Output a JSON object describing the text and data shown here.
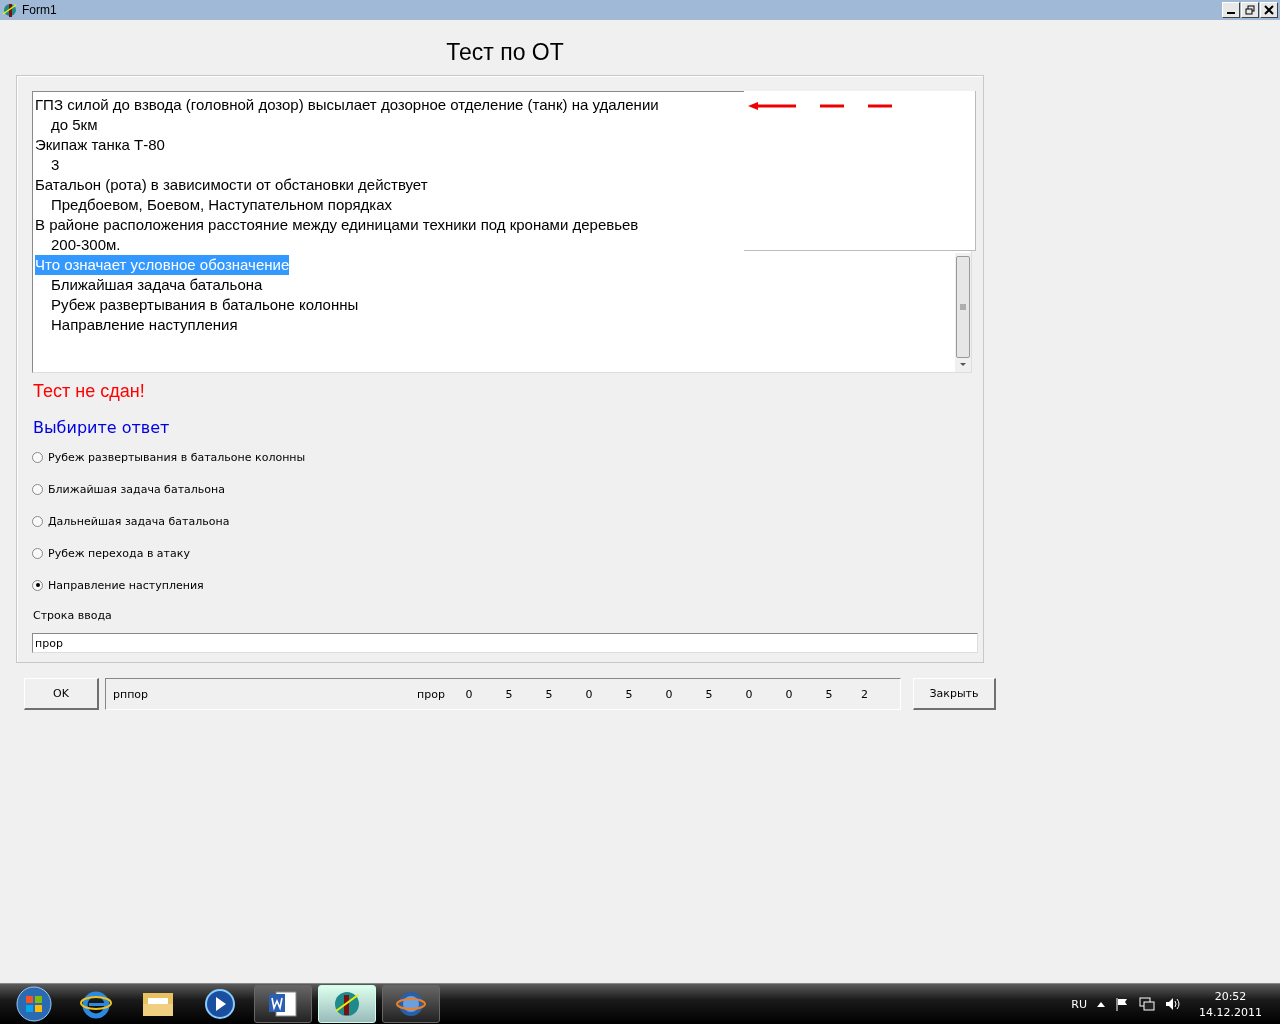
{
  "window": {
    "title": "Form1",
    "controls": [
      {
        "kind": "minimize"
      },
      {
        "kind": "restore"
      },
      {
        "kind": "close"
      }
    ]
  },
  "heading": "Тест по ОТ",
  "memo": {
    "items": [
      {
        "text": "ГПЗ силой до взвода (головной дозор) высылает дозорное отделение (танк) на удалении",
        "selected": false,
        "children": [
          {
            "text": "до 5км",
            "selected": false
          }
        ]
      },
      {
        "text": "Экипаж танка Т-80",
        "selected": false,
        "children": [
          {
            "text": "3",
            "selected": false
          }
        ]
      },
      {
        "text": "Батальон (рота) в зависимости от обстановки действует",
        "selected": false,
        "children": [
          {
            "text": "Предбоевом, Боевом, Наступательном порядках",
            "selected": false
          }
        ]
      },
      {
        "text": "В районе расположения расстояние между единицами техники под кронами деревьев",
        "selected": false,
        "children": [
          {
            "text": "200-300м.",
            "selected": false
          }
        ]
      },
      {
        "text": "Что означает условное обозначение",
        "selected": true,
        "children": [
          {
            "text": "Ближайшая задача батальона",
            "selected": false
          },
          {
            "text": "Рубеж развертывания в батальоне колонны",
            "selected": false
          },
          {
            "text": "Направление наступления",
            "selected": false
          }
        ]
      }
    ]
  },
  "result": "Тест не сдан!",
  "prompt": "Выбирите ответ",
  "options": [
    {
      "label": "Рубеж развертывания в батальоне колонны",
      "selected": false
    },
    {
      "label": "Ближайшая задача батальона",
      "selected": false
    },
    {
      "label": "Дальнейшая задача батальона",
      "selected": false
    },
    {
      "label": "Рубеж перехода в атаку",
      "selected": false
    },
    {
      "label": "Направление наступления",
      "selected": true
    }
  ],
  "input": {
    "label": "Строка ввода",
    "value": "прор"
  },
  "ok_button": "OK",
  "status": {
    "text_1": "рппор",
    "text_2": "прор",
    "scores": [
      "0",
      "5",
      "5",
      "0",
      "5",
      "0",
      "5",
      "0",
      "0",
      "5"
    ],
    "total": "2"
  },
  "close_button": "Закрыть",
  "taskbar": {
    "apps": [
      {
        "kind": "word",
        "selected": false
      },
      {
        "kind": "app",
        "selected": true
      },
      {
        "kind": "globe",
        "selected": false
      }
    ],
    "language": "RU",
    "time": "20:52",
    "date": "14.12.2011"
  }
}
